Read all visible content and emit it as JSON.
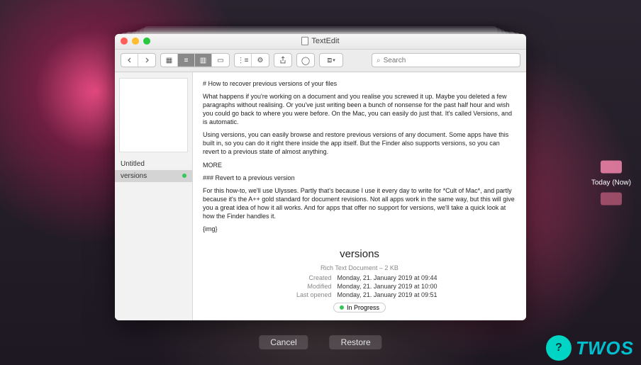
{
  "app": {
    "title": "TextEdit"
  },
  "toolbar": {
    "search_placeholder": "Search"
  },
  "sidebar": {
    "items": [
      {
        "label": "Untitled"
      },
      {
        "label": "versions"
      }
    ]
  },
  "document": {
    "h1": "# How to recover previous versions of your files",
    "p1": "What happens if you're working on a document and you realise you screwed it up. Maybe you deleted a few paragraphs without realising. Or you've just writing been a bunch of nonsense for the past half hour and wish you could go back to where you were before. On the Mac, you can easily do just that. It's called Versions, and is automatic.",
    "p2": "Using versions, you can easily browse and restore previous versions of any document. Some apps have this built in, so you can do it right there inside the app itself. But the Finder also supports versions, so you can revert to a previous state of almost anything.",
    "p3": "MORE",
    "p4": "### Revert to a previous version",
    "p5": "For this how-to, we'll use Ulysses. Partly that's because I use it every day to write for *Cult of Mac*, and partly because it's the A++ gold standard for document revisions. Not all apps work in the same way, but this will give you a great idea of how it all works. And for apps that offer no support for versions, we'll take a quick look at how the Finder handles it.",
    "p6": "{img}"
  },
  "meta": {
    "title": "versions",
    "subtitle": "Rich Text Document – 2 KB",
    "created_label": "Created",
    "created_value": "Monday, 21. January 2019 at 09:44",
    "modified_label": "Modified",
    "modified_value": "Monday, 21. January 2019 at 10:00",
    "lastopened_label": "Last opened",
    "lastopened_value": "Monday, 21. January 2019 at 09:51",
    "tag": "In Progress"
  },
  "timeline": {
    "label": "Today (Now)"
  },
  "footer": {
    "cancel": "Cancel",
    "restore": "Restore"
  },
  "watermark": {
    "badge": "?",
    "text": "TWOS"
  }
}
